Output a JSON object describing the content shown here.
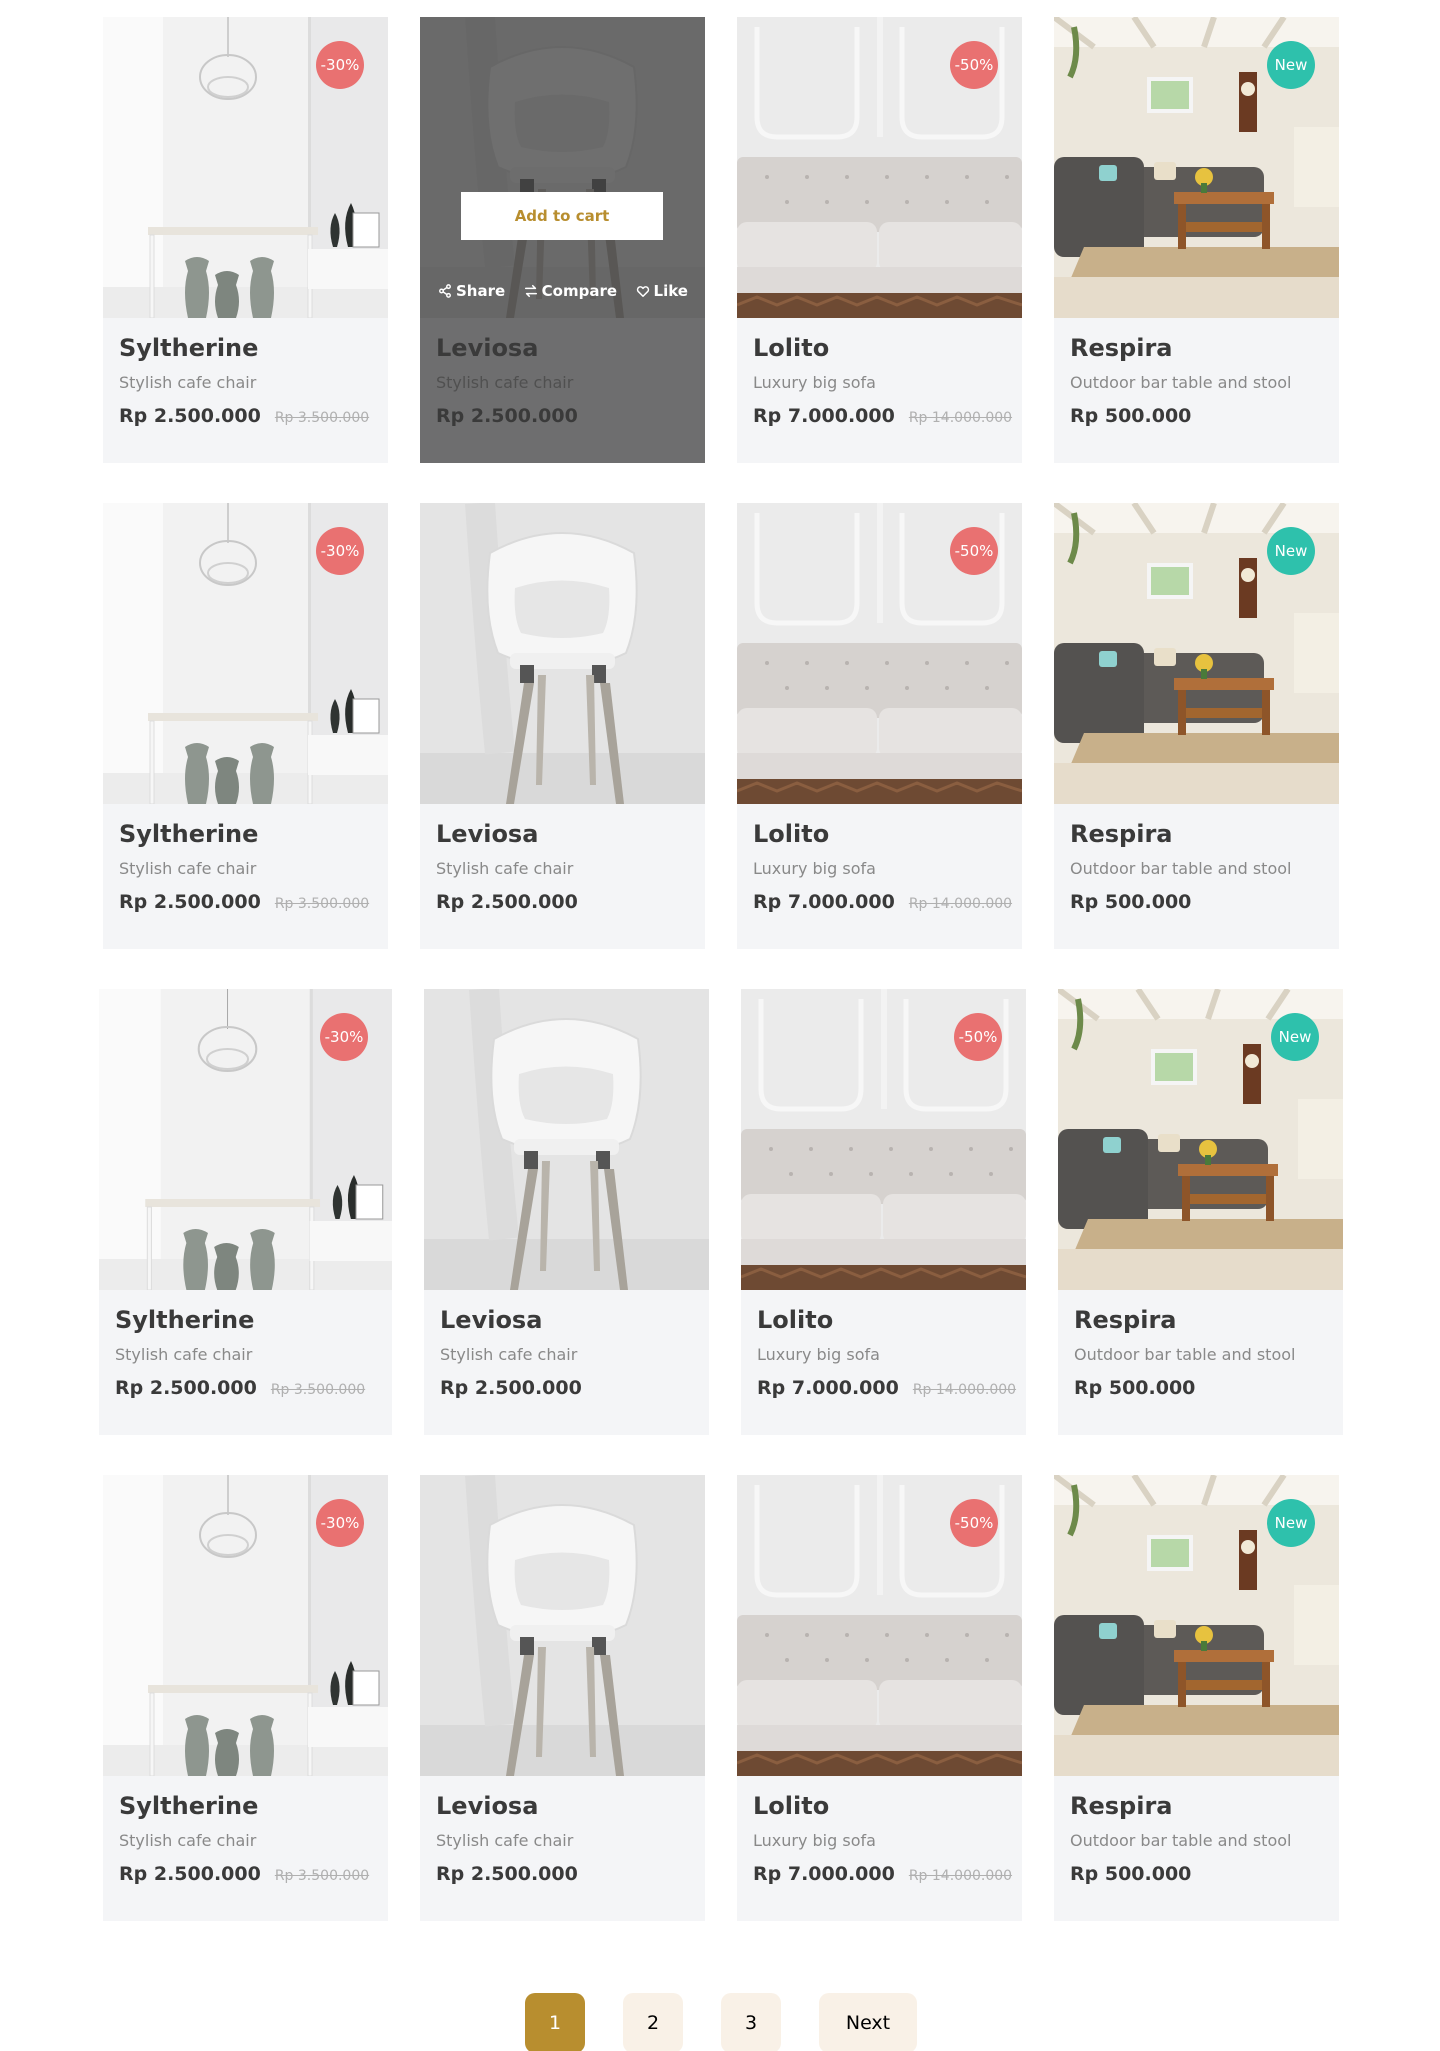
{
  "products": [
    {
      "name": "Syltherine",
      "subtitle": "Stylish cafe chair",
      "price": "Rp 2.500.000",
      "old_price": "Rp 3.500.000",
      "badge": "-30%",
      "badge_type": "sale"
    },
    {
      "name": "Leviosa",
      "subtitle": "Stylish cafe chair",
      "price": "Rp 2.500.000",
      "old_price": "",
      "badge": "",
      "badge_type": ""
    },
    {
      "name": "Lolito",
      "subtitle": "Luxury big sofa",
      "price": "Rp 7.000.000",
      "old_price": "Rp 14.000.000",
      "badge": "-50%",
      "badge_type": "sale"
    },
    {
      "name": "Respira",
      "subtitle": "Outdoor bar table and stool",
      "price": "Rp 500.000",
      "old_price": "",
      "badge": "New",
      "badge_type": "new"
    }
  ],
  "hover": {
    "add_to_cart": "Add to cart",
    "share": "Share",
    "compare": "Compare",
    "like": "Like"
  },
  "pagination": {
    "pages": [
      "1",
      "2",
      "3"
    ],
    "active": "1",
    "next": "Next"
  },
  "colors": {
    "accent": "#b88e2f",
    "sale_badge": "#e97171",
    "new_badge": "#2ec1ac",
    "card_bg": "#f4f5f7"
  }
}
